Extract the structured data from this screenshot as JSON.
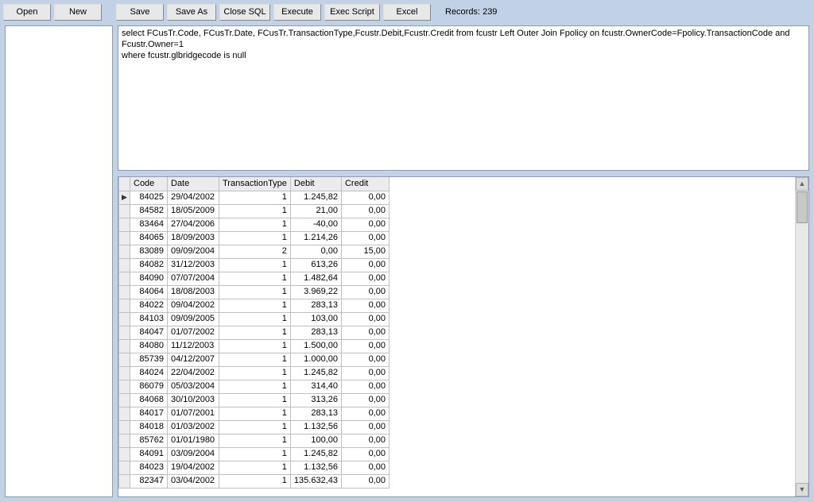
{
  "toolbar": {
    "open": "Open",
    "new": "New",
    "save": "Save",
    "saveas": "Save As",
    "closesql": "Close SQL",
    "execute": "Execute",
    "execscript": "Exec Script",
    "excel": "Excel"
  },
  "status": {
    "records_label": "Records: 239"
  },
  "sql_text": "select FCusTr.Code, FCusTr.Date, FCusTr.TransactionType,Fcustr.Debit,Fcustr.Credit from fcustr Left Outer Join Fpolicy on fcustr.OwnerCode=Fpolicy.TransactionCode and Fcustr.Owner=1\nwhere fcustr.glbridgecode is null",
  "grid": {
    "columns": [
      "Code",
      "Date",
      "TransactionType",
      "Debit",
      "Credit"
    ],
    "rows": [
      {
        "ind": "▶",
        "code": "84025",
        "date": "29/04/2002",
        "ttype": "1",
        "debit": "1.245,82",
        "credit": "0,00"
      },
      {
        "ind": "",
        "code": "84582",
        "date": "18/05/2009",
        "ttype": "1",
        "debit": "21,00",
        "credit": "0,00"
      },
      {
        "ind": "",
        "code": "83464",
        "date": "27/04/2006",
        "ttype": "1",
        "debit": "-40,00",
        "credit": "0,00"
      },
      {
        "ind": "",
        "code": "84065",
        "date": "18/09/2003",
        "ttype": "1",
        "debit": "1.214,26",
        "credit": "0,00"
      },
      {
        "ind": "",
        "code": "83089",
        "date": "09/09/2004",
        "ttype": "2",
        "debit": "0,00",
        "credit": "15,00"
      },
      {
        "ind": "",
        "code": "84082",
        "date": "31/12/2003",
        "ttype": "1",
        "debit": "613,26",
        "credit": "0,00"
      },
      {
        "ind": "",
        "code": "84090",
        "date": "07/07/2004",
        "ttype": "1",
        "debit": "1.482,64",
        "credit": "0,00"
      },
      {
        "ind": "",
        "code": "84064",
        "date": "18/08/2003",
        "ttype": "1",
        "debit": "3.969,22",
        "credit": "0,00"
      },
      {
        "ind": "",
        "code": "84022",
        "date": "09/04/2002",
        "ttype": "1",
        "debit": "283,13",
        "credit": "0,00"
      },
      {
        "ind": "",
        "code": "84103",
        "date": "09/09/2005",
        "ttype": "1",
        "debit": "103,00",
        "credit": "0,00"
      },
      {
        "ind": "",
        "code": "84047",
        "date": "01/07/2002",
        "ttype": "1",
        "debit": "283,13",
        "credit": "0,00"
      },
      {
        "ind": "",
        "code": "84080",
        "date": "11/12/2003",
        "ttype": "1",
        "debit": "1.500,00",
        "credit": "0,00"
      },
      {
        "ind": "",
        "code": "85739",
        "date": "04/12/2007",
        "ttype": "1",
        "debit": "1.000,00",
        "credit": "0,00"
      },
      {
        "ind": "",
        "code": "84024",
        "date": "22/04/2002",
        "ttype": "1",
        "debit": "1.245,82",
        "credit": "0,00"
      },
      {
        "ind": "",
        "code": "86079",
        "date": "05/03/2004",
        "ttype": "1",
        "debit": "314,40",
        "credit": "0,00"
      },
      {
        "ind": "",
        "code": "84068",
        "date": "30/10/2003",
        "ttype": "1",
        "debit": "313,26",
        "credit": "0,00"
      },
      {
        "ind": "",
        "code": "84017",
        "date": "01/07/2001",
        "ttype": "1",
        "debit": "283,13",
        "credit": "0,00"
      },
      {
        "ind": "",
        "code": "84018",
        "date": "01/03/2002",
        "ttype": "1",
        "debit": "1.132,56",
        "credit": "0,00"
      },
      {
        "ind": "",
        "code": "85762",
        "date": "01/01/1980",
        "ttype": "1",
        "debit": "100,00",
        "credit": "0,00"
      },
      {
        "ind": "",
        "code": "84091",
        "date": "03/09/2004",
        "ttype": "1",
        "debit": "1.245,82",
        "credit": "0,00"
      },
      {
        "ind": "",
        "code": "84023",
        "date": "19/04/2002",
        "ttype": "1",
        "debit": "1.132,56",
        "credit": "0,00"
      },
      {
        "ind": "",
        "code": "82347",
        "date": "03/04/2002",
        "ttype": "1",
        "debit": "135.632,43",
        "credit": "0,00"
      }
    ]
  }
}
